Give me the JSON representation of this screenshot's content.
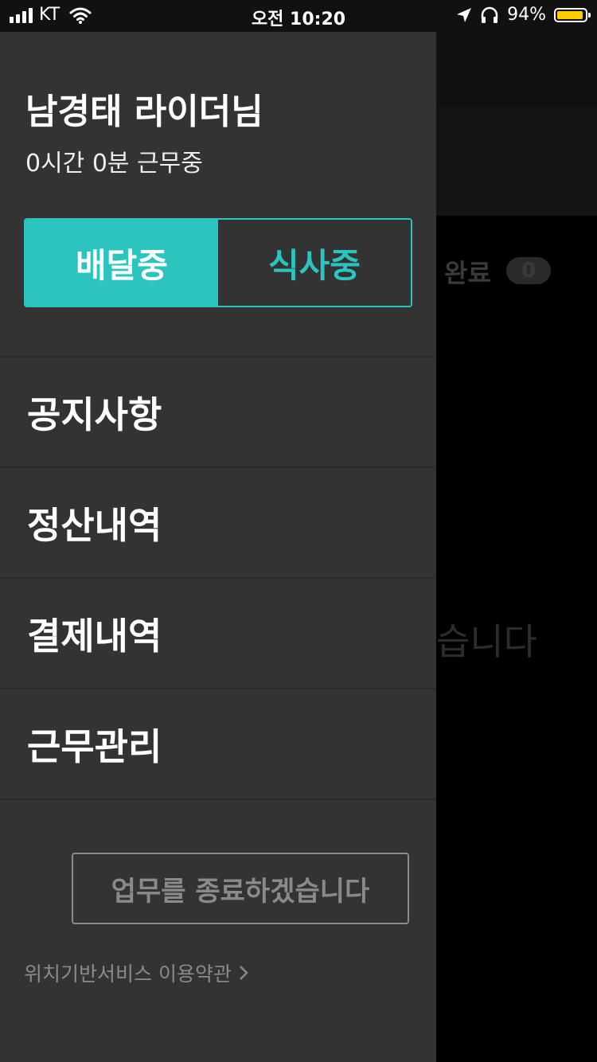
{
  "status_bar": {
    "carrier": "KT",
    "time": "오전 10:20",
    "battery_percent": "94%",
    "battery_level": 0.94,
    "battery_color": "#ffcc00",
    "icons": [
      "signal-icon",
      "wifi-icon",
      "location-arrow-icon",
      "headphones-icon",
      "battery-icon"
    ]
  },
  "background": {
    "tab_label": "완료",
    "tab_count": "0",
    "empty_message_fragment": "습니다"
  },
  "drawer": {
    "rider_name": "남경태 라이더님",
    "work_time": "0시간 0분 근무중",
    "status_toggle": {
      "active_label": "배달중",
      "inactive_label": "식사중",
      "accent_color": "#2bc4be"
    },
    "menu": [
      {
        "label": "공지사항"
      },
      {
        "label": "정산내역"
      },
      {
        "label": "결제내역"
      },
      {
        "label": "근무관리"
      }
    ],
    "end_work_button": "업무를 종료하겠습니다",
    "terms_link": "위치기반서비스 이용약관"
  }
}
